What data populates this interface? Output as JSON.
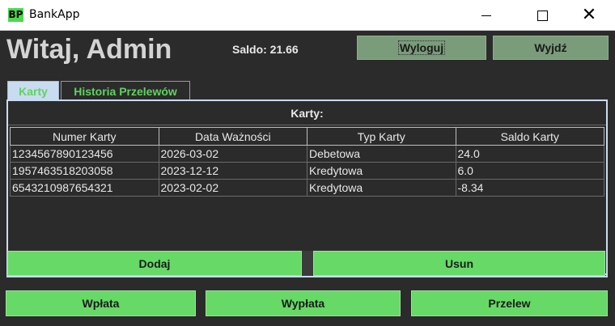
{
  "window": {
    "icon_text": "BP",
    "title": "BankApp",
    "minimize_glyph": "",
    "maximize_glyph": "",
    "close_glyph": "✕"
  },
  "header": {
    "greeting": "Witaj, Admin",
    "saldo": "Saldo: 21.66",
    "logout_label": "Wyloguj",
    "exit_label": "Wyjdź"
  },
  "tabs": [
    {
      "label": "Karty",
      "active": true
    },
    {
      "label": "Historia Przelewów",
      "active": false
    }
  ],
  "cards_panel": {
    "title": "Karty:",
    "columns": [
      "Numer Karty",
      "Data Ważności",
      "Typ Karty",
      "Saldo Karty"
    ],
    "rows": [
      [
        "1234567890123456",
        "2026-03-02",
        "Debetowa",
        "24.0"
      ],
      [
        "1957463518203058",
        "2023-12-12",
        "Kredytowa",
        "6.0"
      ],
      [
        "6543210987654321",
        "2023-02-02",
        "Kredytowa",
        "-8.34"
      ]
    ],
    "add_label": "Dodaj",
    "remove_label": "Usun"
  },
  "actions": {
    "deposit_label": "Wpłata",
    "withdraw_label": "Wypłata",
    "transfer_label": "Przelew"
  },
  "colors": {
    "accent_green": "#66d966",
    "background": "#2b2b2b",
    "tab_active": "#c9dbf0",
    "muted_button": "#7a9c7a"
  }
}
